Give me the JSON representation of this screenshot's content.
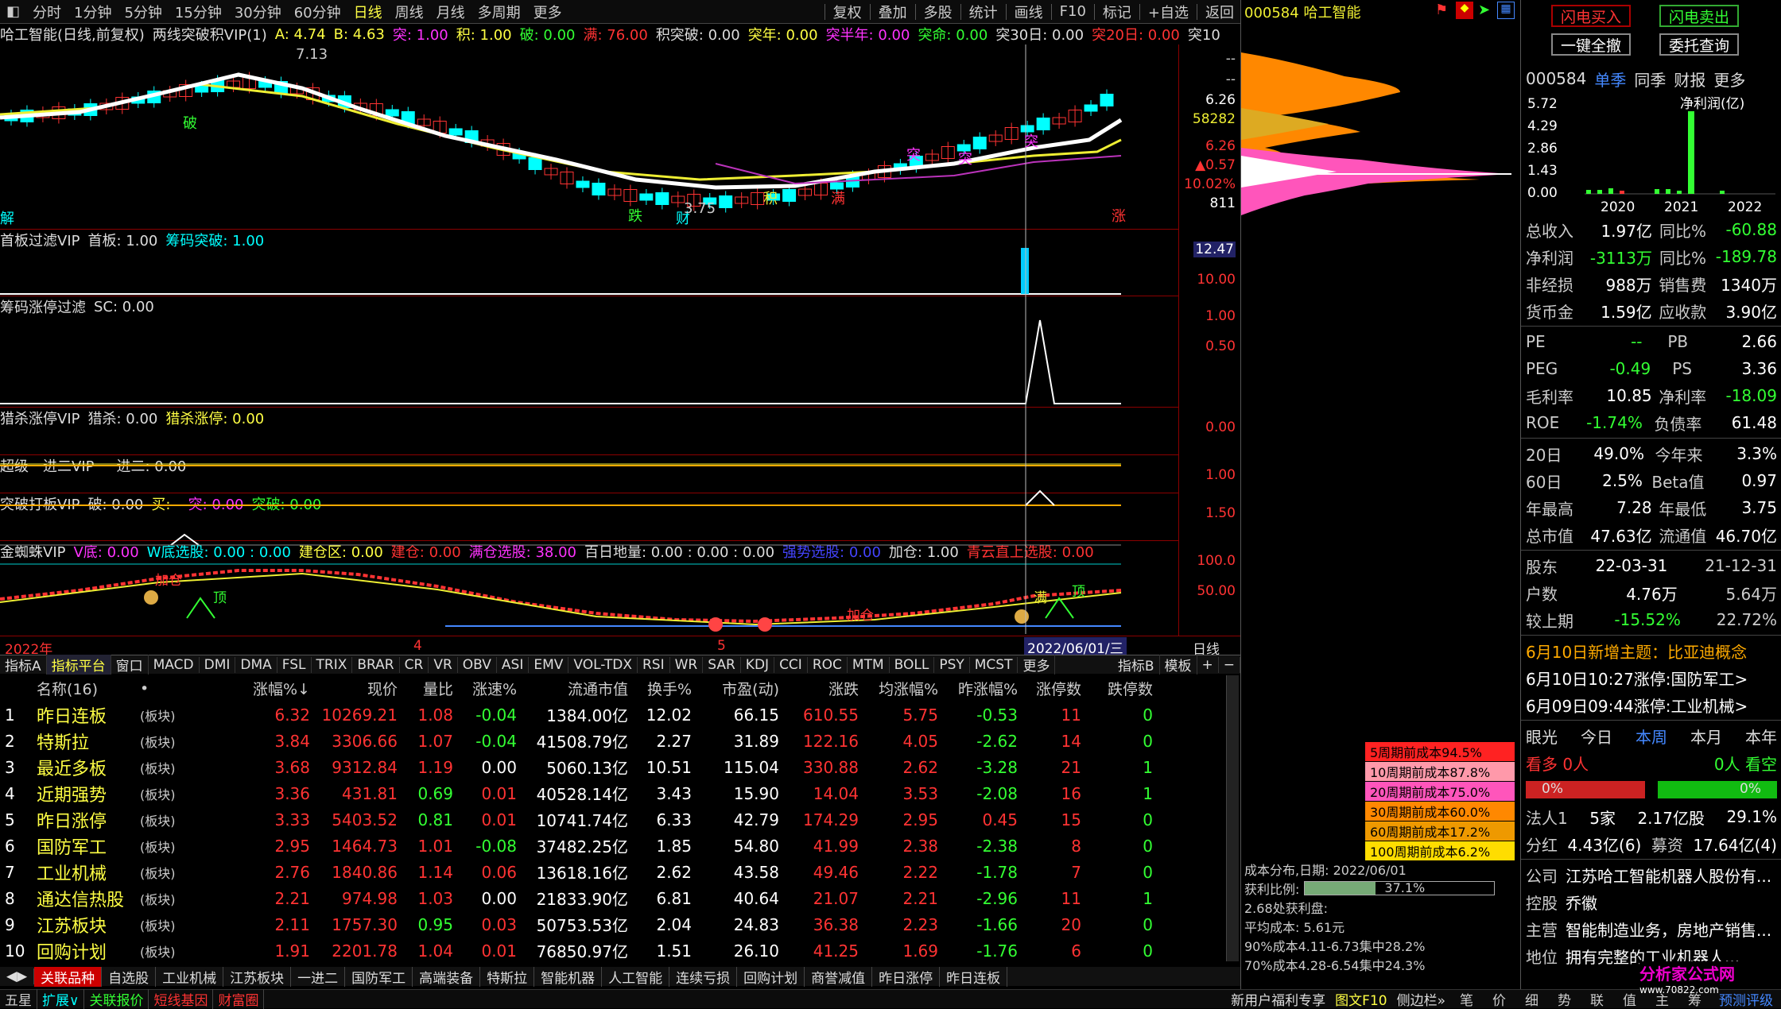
{
  "topbar": {
    "items": [
      "分时",
      "1分钟",
      "5分钟",
      "15分钟",
      "30分钟",
      "60分钟",
      "日线",
      "周线",
      "月线",
      "多周期",
      "更多"
    ],
    "right_items": [
      "复权",
      "叠加",
      "多股",
      "统计",
      "画线",
      "F10",
      "标记",
      "+自选",
      "返回"
    ],
    "selected": "日线"
  },
  "chart_header": {
    "title": "哈工智能(日线,前复权)",
    "indicator": "两线突破积VIP(1)",
    "a_label": "A: 4.74",
    "b_label": "B: 4.63",
    "tu": "突: 1.00",
    "ji": "积: 1.00",
    "po": "破: 0.00",
    "man": "满: 76.00",
    "jitupo": "积突破: 0.00",
    "tunian": "突年: 0.00",
    "tubannian": "突半年: 0.00",
    "tuming": "突命: 0.00",
    "tu30": "突30日: 0.00",
    "tu20": "突20日: 0.00",
    "tu10": "突10"
  },
  "price_axis": [
    "--",
    "--",
    "6.26",
    "58282",
    "6.26",
    "▲0.57",
    "10.02%",
    "811"
  ],
  "annotations": {
    "high": "7.13",
    "low": "3.75",
    "jie": "解",
    "po": "破",
    "die": "跌",
    "cai": "财",
    "ji": "积",
    "man": "满",
    "tu1": "突",
    "tu2": "突",
    "tu3": "突",
    "zhang": "涨"
  },
  "panels": [
    {
      "name": "首板过滤VIP",
      "fields": [
        {
          "t": "首板: 1.00",
          "c": "w"
        },
        {
          "t": "筹码突破: 1.00",
          "c": "c"
        }
      ],
      "axis": [
        "12.47",
        "10.00"
      ]
    },
    {
      "name": "筹码涨停过滤",
      "fields": [
        {
          "t": "SC: 0.00",
          "c": "w"
        }
      ],
      "axis": [
        "1.00",
        "0.50"
      ]
    },
    {
      "name": "猎杀涨停VIP",
      "fields": [
        {
          "t": "猎杀: 0.00",
          "c": "w"
        },
        {
          "t": "猎杀涨停: 0.00",
          "c": "y"
        }
      ],
      "axis": [
        "0.00"
      ]
    },
    {
      "name": "超级一进二VIP",
      "fields": [
        {
          "t": "一进二: 0.00",
          "c": "w"
        }
      ],
      "axis": [
        "1.00"
      ]
    },
    {
      "name": "突破打板VIP",
      "fields": [
        {
          "t": "破: 0.00",
          "c": "w"
        },
        {
          "t": "买: -",
          "c": "y"
        },
        {
          "t": "突: 0.00",
          "c": "m"
        },
        {
          "t": "突破: 0.00",
          "c": "g"
        }
      ],
      "axis": [
        "1.50"
      ]
    },
    {
      "name": "金蜘蛛VIP",
      "fields": [
        {
          "t": "V底: 0.00",
          "c": "m"
        },
        {
          "t": "W底选股: 0.00 : 0.00",
          "c": "c"
        },
        {
          "t": "建仓区: 0.00",
          "c": "y"
        },
        {
          "t": "建仓: 0.00",
          "c": "r"
        },
        {
          "t": "满仓选股: 38.00",
          "c": "m"
        },
        {
          "t": "百日地量: 0.00 : 0.00 : 0.00",
          "c": "w"
        },
        {
          "t": "强势选股: 0.00",
          "c": "b"
        },
        {
          "t": "加仓: 1.00",
          "c": "w"
        },
        {
          "t": "青云直上选股: 0.00",
          "c": "r"
        }
      ],
      "axis": [
        "100.0",
        "50.00"
      ]
    }
  ],
  "spider_labels": {
    "jia1": "加仓",
    "ding1": "顶",
    "jia2": "加仓",
    "man": "满",
    "ding2": "顶"
  },
  "time_axis": {
    "start": "2022年",
    "m1": "4",
    "m2": "5",
    "cursor": "2022/06/01/三",
    "right": "日线"
  },
  "tabs1": [
    "指标A",
    "指标平台",
    "窗口",
    "MACD",
    "DMI",
    "DMA",
    "FSL",
    "TRIX",
    "BRAR",
    "CR",
    "VR",
    "OBV",
    "ASI",
    "EMV",
    "VOL-TDX",
    "RSI",
    "WR",
    "SAR",
    "KDJ",
    "CCI",
    "ROC",
    "MTM",
    "BOLL",
    "PSY",
    "MCST",
    "更多"
  ],
  "tabs1_right": [
    "指标B",
    "模板",
    "+",
    "−"
  ],
  "table": {
    "headers": [
      "",
      "名称(16)",
      "•",
      "涨幅%↓",
      "现价",
      "量比",
      "涨速%",
      "流通市值",
      "换手%",
      "市盈(动)",
      "涨跌",
      "均涨幅%",
      "昨涨幅%",
      "涨停数",
      "跌停数"
    ],
    "rows": [
      [
        "1",
        "昨日连板",
        "(板块)",
        "6.32",
        "10269.21",
        "1.08",
        "-0.04",
        "1384.00亿",
        "12.02",
        "66.15",
        "610.55",
        "5.75",
        "-0.53",
        "11",
        "0"
      ],
      [
        "2",
        "特斯拉",
        "(板块)",
        "3.84",
        "3306.66",
        "1.07",
        "-0.04",
        "41508.79亿",
        "2.27",
        "31.89",
        "122.16",
        "4.05",
        "-2.62",
        "14",
        "0"
      ],
      [
        "3",
        "最近多板",
        "(板块)",
        "3.68",
        "9312.84",
        "1.19",
        "0.00",
        "5060.13亿",
        "10.51",
        "115.04",
        "330.88",
        "2.62",
        "-3.28",
        "21",
        "1"
      ],
      [
        "4",
        "近期强势",
        "(板块)",
        "3.36",
        "431.81",
        "0.69",
        "0.01",
        "40528.14亿",
        "3.43",
        "15.90",
        "14.04",
        "3.53",
        "-2.08",
        "16",
        "1"
      ],
      [
        "5",
        "昨日涨停",
        "(板块)",
        "3.33",
        "5403.52",
        "0.81",
        "0.01",
        "10741.74亿",
        "6.33",
        "42.79",
        "174.29",
        "2.95",
        "0.45",
        "15",
        "0"
      ],
      [
        "6",
        "国防军工",
        "(板块)",
        "2.95",
        "1464.73",
        "1.01",
        "-0.08",
        "37482.25亿",
        "1.85",
        "54.80",
        "41.99",
        "2.38",
        "-2.38",
        "8",
        "0"
      ],
      [
        "7",
        "工业机械",
        "(板块)",
        "2.76",
        "1840.86",
        "1.14",
        "0.06",
        "13618.16亿",
        "2.62",
        "43.58",
        "49.46",
        "2.22",
        "-1.78",
        "7",
        "0"
      ],
      [
        "8",
        "通达信热股",
        "(板块)",
        "2.21",
        "974.98",
        "1.03",
        "0.00",
        "21833.90亿",
        "6.81",
        "40.64",
        "21.07",
        "2.21",
        "-2.96",
        "11",
        "1"
      ],
      [
        "9",
        "江苏板块",
        "(板块)",
        "2.11",
        "1757.30",
        "0.95",
        "0.03",
        "50753.53亿",
        "2.04",
        "24.83",
        "36.38",
        "2.23",
        "-1.66",
        "20",
        "0"
      ],
      [
        "10",
        "回购计划",
        "(板块)",
        "1.91",
        "2201.78",
        "1.04",
        "0.01",
        "76850.97亿",
        "1.51",
        "26.10",
        "41.25",
        "1.69",
        "-1.76",
        "6",
        "0"
      ]
    ]
  },
  "tabs2": [
    "关联品种",
    "自选股",
    "工业机械",
    "江苏板块",
    "一进二",
    "国防军工",
    "高端装备",
    "特斯拉",
    "智能机器",
    "人工智能",
    "连续亏损",
    "回购计划",
    "商誉减值",
    "昨日涨停",
    "昨日连板"
  ],
  "status": {
    "left": [
      "五星",
      "扩展∨",
      "关联报价",
      "短线基因",
      "财富圈"
    ],
    "mid": "新用户福利专享",
    "f10": "图文F10",
    "side": "侧边栏»",
    "right": [
      "笔",
      "价",
      "细",
      "势",
      "联",
      "值",
      "主",
      "筹"
    ],
    "pred": "预测评级"
  },
  "mid": {
    "code": "000584",
    "name": "哈工智能",
    "legend": [
      "5周期前成本94.5%",
      "10周期前成本87.8%",
      "20周期前成本75.0%",
      "30周期前成本60.0%",
      "60周期前成本17.2%",
      "100周期前成本6.2%"
    ],
    "legend_colors": [
      "#f22",
      "#f9a",
      "#f5b",
      "#f80",
      "#e90",
      "#fd0"
    ],
    "info": [
      "成本分布,日期: 2022/06/01",
      "获利比例:",
      "37.1%",
      "2.68处获利盘:",
      "平均成本: 5.61元",
      "90%成本4.11-6.73集中28.2%",
      "70%成本4.28-6.54集中24.3%"
    ],
    "profit_ratio": 0.371
  },
  "right": {
    "buttons": [
      "闪电买入",
      "闪电卖出",
      "一键全撤",
      "委托查询"
    ],
    "code": "000584",
    "tabs": [
      "单季",
      "同季",
      "财报",
      "更多"
    ],
    "profit_label": "净利润(亿)",
    "bar_axis": [
      "5.72",
      "4.29",
      "2.86",
      "1.43",
      "0.00"
    ],
    "years": [
      "2020",
      "2021",
      "2022"
    ],
    "fin": [
      [
        "总收入",
        "1.97亿",
        "同比%",
        "-60.88"
      ],
      [
        "净利润",
        "-3113万",
        "同比%",
        "-189.78"
      ],
      [
        "非经损",
        "988万",
        "销售费",
        "1340万"
      ],
      [
        "货币金",
        "1.59亿",
        "应收款",
        "3.90亿"
      ]
    ],
    "val": [
      [
        "PE",
        "--",
        "PB",
        "2.66"
      ],
      [
        "PEG",
        "-0.49",
        "PS",
        "3.36"
      ],
      [
        "毛利率",
        "10.85",
        "净利率",
        "-18.09"
      ],
      [
        "ROE",
        "-1.74%",
        "负债率",
        "61.48"
      ]
    ],
    "perf": [
      [
        "20日",
        "49.0%",
        "今年来",
        "3.3%"
      ],
      [
        "60日",
        "2.5%",
        "Beta值",
        "0.97"
      ],
      [
        "年最高",
        "7.28",
        "年最低",
        "3.75"
      ],
      [
        "总市值",
        "47.63亿",
        "流通值",
        "46.70亿"
      ]
    ],
    "holders": [
      [
        "股东",
        "22-03-31",
        "21-12-31"
      ],
      [
        "户数",
        "4.76万",
        "5.64万"
      ],
      [
        "较上期",
        "-15.52%",
        "22.72%"
      ]
    ],
    "theme": "6月10日新增主题：比亚迪概念",
    "news": [
      "6月10日10:27涨停:国防军工>",
      "6月09日09:44涨停:工业机械>"
    ],
    "eye": [
      "眼光",
      "今日",
      "本周",
      "本月",
      "本年"
    ],
    "kanduo": "看多 0人",
    "kankong": "0人 看空",
    "pct_left": "0%",
    "pct_right": "0%",
    "faren": [
      "法人1",
      "5家",
      "2.17亿股",
      "29.1%"
    ],
    "fenhong": [
      "分红",
      "4.43亿(6)",
      "募资",
      "17.64亿(4)"
    ],
    "company": [
      [
        "公司",
        "江苏哈工智能机器人股份有..."
      ],
      [
        "控股",
        "乔徽"
      ],
      [
        "主营",
        "智能制造业务，房地产销售..."
      ],
      [
        "地位",
        "拥有完整的工业机器人..."
      ]
    ],
    "watermark": "分析家公式网",
    "watermark_url": "www.70822.com"
  }
}
